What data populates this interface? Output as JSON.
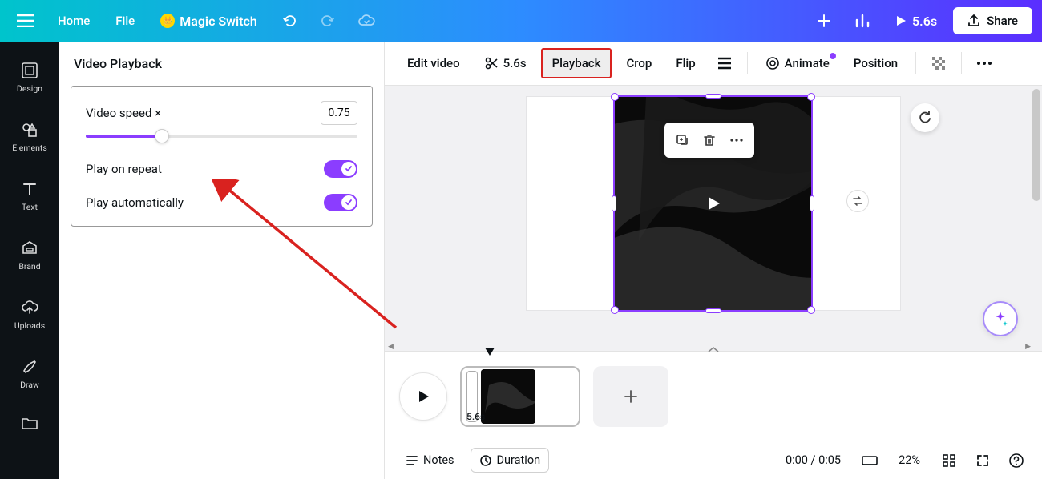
{
  "header": {
    "home": "Home",
    "file": "File",
    "magic_switch": "Magic Switch",
    "duration": "5.6s",
    "share": "Share"
  },
  "rail": {
    "design": "Design",
    "elements": "Elements",
    "text": "Text",
    "brand": "Brand",
    "uploads": "Uploads",
    "draw": "Draw"
  },
  "panel": {
    "title": "Video Playback",
    "speed_label": "Video speed ×",
    "speed_value": "0.75",
    "slider_percent": 28,
    "repeat_label": "Play on repeat",
    "autoplay_label": "Play automatically"
  },
  "toolbar": {
    "edit_video": "Edit video",
    "scissors_duration": "5.6s",
    "playback": "Playback",
    "crop": "Crop",
    "flip": "Flip",
    "animate": "Animate",
    "position": "Position"
  },
  "timeline": {
    "clip_duration": "5.6s"
  },
  "bottombar": {
    "notes": "Notes",
    "duration": "Duration",
    "time": "0:00 / 0:05",
    "zoom": "22%"
  }
}
